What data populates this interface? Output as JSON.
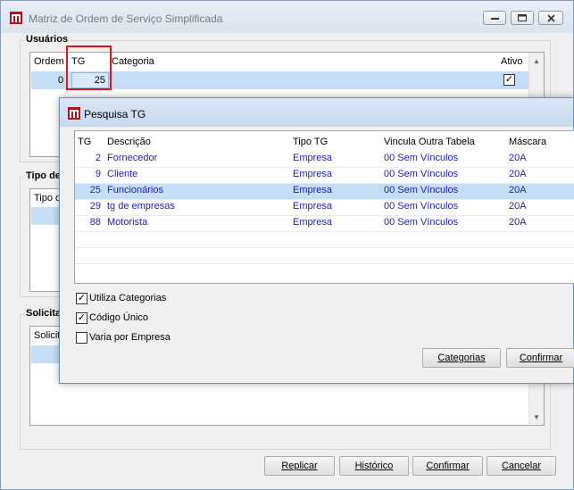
{
  "window": {
    "title": "Matriz de Ordem de Serviço Simplificada"
  },
  "usuarios": {
    "group_title": "Usuários",
    "columns": [
      "Ordem",
      "TG",
      "Categoria",
      "Ativo"
    ],
    "row": {
      "ordem": "0",
      "tg": "25",
      "categoria": "",
      "ativo_checked": true
    }
  },
  "tipo_group": {
    "group_title": "Tipo de",
    "column_fragment": "Tipo de"
  },
  "solicita_group": {
    "group_title": "Solicita",
    "column_fragment": "Solicita"
  },
  "main_buttons": {
    "replicar": "Replicar",
    "historico": "Histórico",
    "confirmar": "Confirmar",
    "cancelar": "Cancelar"
  },
  "dialog": {
    "title": "Pesquisa TG",
    "columns": [
      "TG",
      "Descrição",
      "Tipo TG",
      "Vincula Outra Tabela",
      "Máscara"
    ],
    "rows": [
      {
        "tg": "2",
        "descricao": "Fornecedor",
        "tipo": "Empresa",
        "vincula": "00 Sem Vínculos",
        "mascara": "20A"
      },
      {
        "tg": "9",
        "descricao": "Cliente",
        "tipo": "Empresa",
        "vincula": "00 Sem Vínculos",
        "mascara": "20A"
      },
      {
        "tg": "25",
        "descricao": "Funcionários",
        "tipo": "Empresa",
        "vincula": "00 Sem Vínculos",
        "mascara": "20A"
      },
      {
        "tg": "29",
        "descricao": "tg de empresas",
        "tipo": "Empresa",
        "vincula": "00 Sem Vínculos",
        "mascara": "20A"
      },
      {
        "tg": "88",
        "descricao": "Motorista",
        "tipo": "Empresa",
        "vincula": "00 Sem Vínculos",
        "mascara": "20A"
      }
    ],
    "selected_row": 2,
    "checkboxes": [
      {
        "label": "Utiliza Categorias",
        "checked": true
      },
      {
        "label": "Código Único",
        "checked": true
      },
      {
        "label": "Varia por Empresa",
        "checked": false
      }
    ],
    "buttons": {
      "categorias": "Categorias",
      "confirmar": "Confirmar"
    }
  },
  "colors": {
    "selection": "#c5def5",
    "row_text": "#1c1cae",
    "highlight_border": "#e3121b"
  }
}
